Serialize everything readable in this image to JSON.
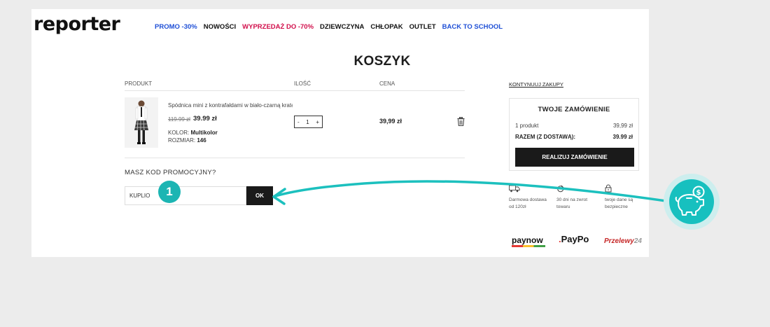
{
  "logo": "reporter",
  "nav": [
    {
      "label": "PROMO -30%",
      "color": "#1e4fd6"
    },
    {
      "label": "NOWOŚCI",
      "color": "#111111"
    },
    {
      "label": "WYPRZEDAŻ DO -70%",
      "color": "#d10f4b"
    },
    {
      "label": "DZIEWCZYNA",
      "color": "#111111"
    },
    {
      "label": "CHŁOPAK",
      "color": "#111111"
    },
    {
      "label": "OUTLET",
      "color": "#111111"
    },
    {
      "label": "BACK TO SCHOOL",
      "color": "#1e4fd6"
    }
  ],
  "page_title": "KOSZYK",
  "cart": {
    "headers": {
      "product": "PRODUKT",
      "qty": "ILOŚĆ",
      "price": "CENA"
    },
    "item": {
      "name": "Spódnica mini z kontrafałdami w biało-czarną kratę",
      "old_price": "119.99 zł",
      "new_price": "39.99 zł",
      "color_label": "KOLOR:",
      "color_value": "Multikolor",
      "size_label": "ROZMIAR:",
      "size_value": "146",
      "qty": "1",
      "minus": "-",
      "plus": "+",
      "line_price": "39,99 zł"
    }
  },
  "promo": {
    "label": "MASZ KOD PROMOCYJNY?",
    "value": "KUPLIO",
    "button": "OK",
    "step": "1"
  },
  "sidebar": {
    "continue": "KONTYNUUJ ZAKUPY",
    "summary_title": "TWOJE ZAMÓWIENIE",
    "products_label": "1 produkt",
    "products_value": "39,99 zł",
    "total_label": "RAZEM (Z DOSTAWĄ):",
    "total_value": "39.99 zł",
    "checkout": "REALIZUJ ZAMÓWIENIE",
    "features": [
      {
        "text": "Darmowa dostawa od 120zł",
        "icon": "truck-icon"
      },
      {
        "text": "30 dni na zwrot towaru",
        "icon": "return-icon"
      },
      {
        "text": "twoje dane są bezpieczne",
        "icon": "lock-icon"
      }
    ],
    "payments": {
      "paynow": "paynow",
      "paypo": "PayPo",
      "przelewy": "Przelewy",
      "przelewy_num": "24"
    }
  },
  "accent": "#1cb5b3"
}
